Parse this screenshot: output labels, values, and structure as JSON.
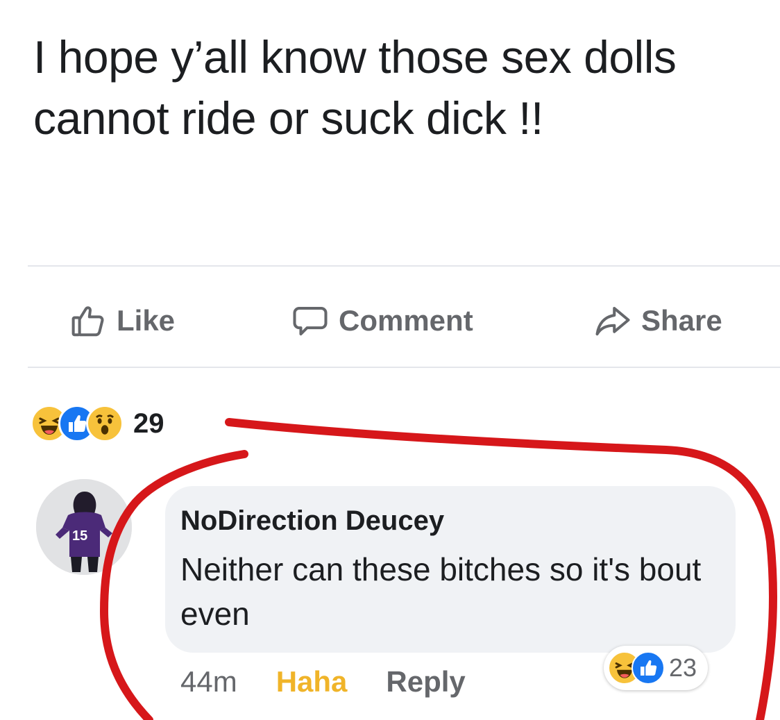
{
  "post": {
    "text": "I hope y’all know those sex dolls cannot ride or suck dick  !!"
  },
  "actions": {
    "like_label": "Like",
    "comment_label": "Comment",
    "share_label": "Share"
  },
  "reactions": {
    "icons": [
      "haha-emoji",
      "like-emoji",
      "wow-emoji"
    ],
    "count": "29"
  },
  "comment": {
    "author": "NoDirection Deucey",
    "text": "Neither can these bitches so it's bout even",
    "time": "44m",
    "haha_label": "Haha",
    "reply_label": "Reply",
    "reaction_icons": [
      "haha-emoji",
      "like-emoji"
    ],
    "reaction_count": "23",
    "avatar_jersey_number": "15"
  },
  "colors": {
    "annotation": "#d6171a",
    "haha_accent": "#f0b429",
    "like_blue": "#1877f2",
    "muted_text": "#65676b",
    "bubble": "#f0f2f5"
  }
}
